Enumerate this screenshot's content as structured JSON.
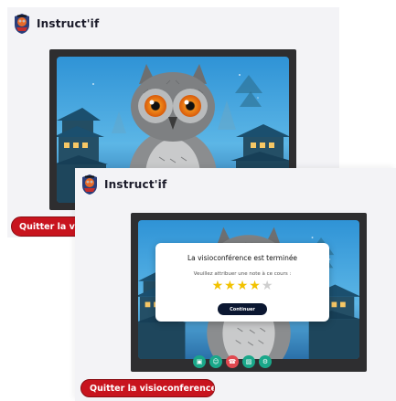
{
  "app": {
    "name": "Instruct'if"
  },
  "call_view": {
    "quit_label": "Quitter la visioconference"
  },
  "end_view": {
    "quit_label": "Quitter la visioconference",
    "modal": {
      "title": "La visioconférence est terminée",
      "subtitle": "Veuillez attribuer une note à ce cours :",
      "rating": 4,
      "max_rating": 5,
      "continue_label": "Continuer"
    },
    "controls": [
      {
        "icon": "screen-share-icon",
        "color": "#1aa88a"
      },
      {
        "icon": "participant-icon",
        "color": "#1aa88a"
      },
      {
        "icon": "hang-up-icon",
        "color": "#e0484f"
      },
      {
        "icon": "image-icon",
        "color": "#1aa88a"
      },
      {
        "icon": "settings-icon",
        "color": "#1aa88a"
      }
    ]
  },
  "colors": {
    "quit_button": "#c8141e",
    "continue_button": "#0b1731",
    "star_filled": "#f2c200",
    "star_empty": "#cfcfcf",
    "frame": "#2e2e30"
  }
}
